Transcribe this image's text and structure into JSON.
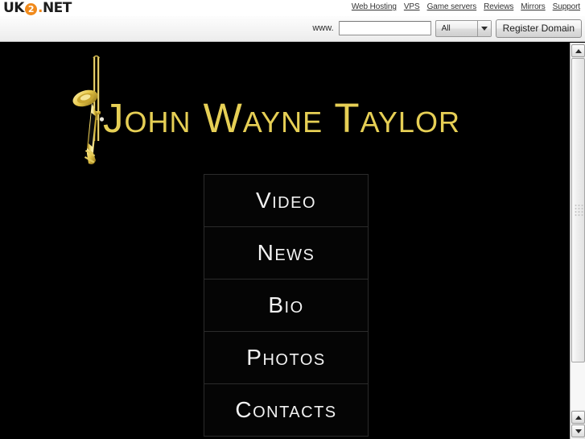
{
  "host_bar": {
    "logo": {
      "prefix": "UK",
      "badge": "2",
      "dot": ".",
      "suffix": "NET"
    },
    "nav_links": [
      {
        "label": "Web Hosting"
      },
      {
        "label": "VPS"
      },
      {
        "label": "Game servers"
      },
      {
        "label": "Reviews"
      },
      {
        "label": "Mirrors"
      },
      {
        "label": "Support"
      }
    ]
  },
  "search_strip": {
    "www_label": "www.",
    "domain_value": "",
    "domain_placeholder": "",
    "tld_selected": "All",
    "tld_options": [
      "All"
    ],
    "register_label": "Register Domain"
  },
  "site": {
    "title": "John Wayne Taylor",
    "title_color": "#e6cf55",
    "background_color": "#000000",
    "trombone_alt": "trombone-icon",
    "menu": [
      {
        "label": "Video"
      },
      {
        "label": "News"
      },
      {
        "label": "Bio"
      },
      {
        "label": "Photos"
      },
      {
        "label": "Contacts"
      }
    ]
  },
  "scrollbar": {
    "up_top": "▲",
    "up_bottom": "▲",
    "down_bottom": "▼"
  }
}
